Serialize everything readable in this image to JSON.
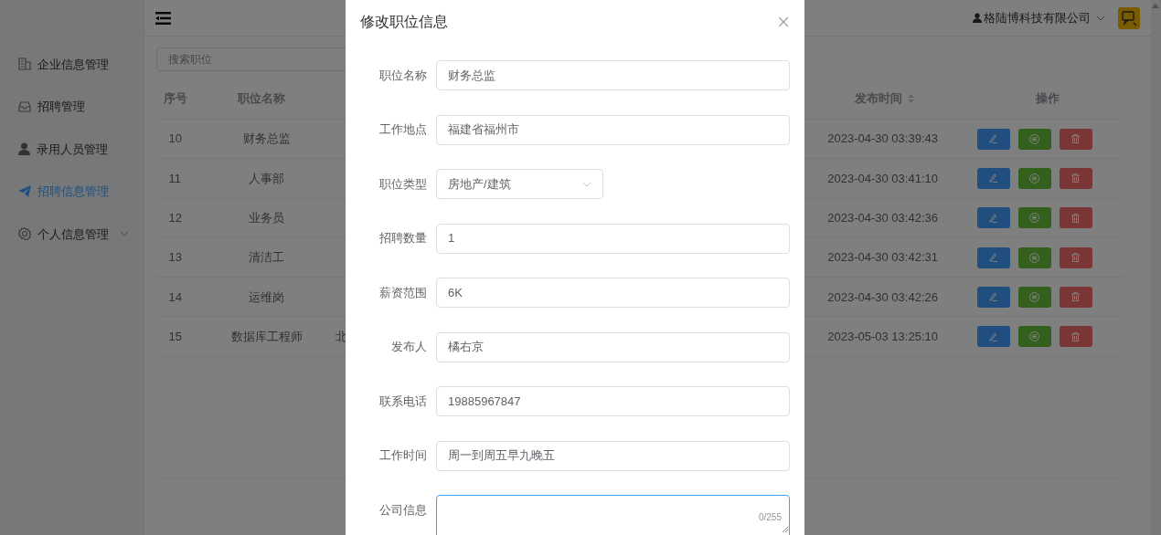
{
  "header": {
    "company": "格陆博科技有限公司"
  },
  "sidebar": {
    "items": [
      {
        "label": "企业信息管理",
        "selected": false,
        "expandable": false
      },
      {
        "label": "招聘管理",
        "selected": false,
        "expandable": false
      },
      {
        "label": "录用人员管理",
        "selected": false,
        "expandable": false
      },
      {
        "label": "招聘信息管理",
        "selected": true,
        "expandable": false
      },
      {
        "label": "个人信息管理",
        "selected": false,
        "expandable": true
      }
    ]
  },
  "search": {
    "placeholder": "搜索职位"
  },
  "table": {
    "columns": [
      "序号",
      "职位名称",
      "发布时间",
      "操作"
    ],
    "rows": [
      {
        "cells": [
          "10",
          "财务总监",
          "2023-04-30 03:39:43"
        ]
      },
      {
        "cells": [
          "11",
          "人事部",
          "2023-04-30 03:41:10"
        ]
      },
      {
        "cells": [
          "12",
          "业务员",
          "2023-04-30 03:42:36"
        ]
      },
      {
        "cells": [
          "13",
          "清洁工",
          "2023-04-30 03:42:31"
        ]
      },
      {
        "cells": [
          "14",
          "运维岗",
          "2023-04-30 03:42:26"
        ]
      },
      {
        "cells": [
          "15",
          "数据库工程师",
          "2023-05-03 13:25:10"
        ],
        "cut_off_text": "北"
      }
    ]
  },
  "dialog": {
    "title": "修改职位信息",
    "fields": [
      {
        "kind": "text",
        "label": "职位名称",
        "value": "财务总监"
      },
      {
        "kind": "text",
        "label": "工作地点",
        "value": "福建省福州市"
      },
      {
        "kind": "select",
        "label": "职位类型",
        "value": "房地产/建筑"
      },
      {
        "kind": "text",
        "label": "招聘数量",
        "value": "1"
      },
      {
        "kind": "text",
        "label": "薪资范围",
        "value": "6K"
      },
      {
        "kind": "text",
        "label": "发布人",
        "value": "橘右京"
      },
      {
        "kind": "text",
        "label": "联系电话",
        "value": "19885967847"
      },
      {
        "kind": "text",
        "label": "工作时间",
        "value": "周一到周五早九晚五"
      },
      {
        "kind": "textarea",
        "label": "公司信息",
        "counter": "0/255",
        "focused": true
      }
    ]
  }
}
